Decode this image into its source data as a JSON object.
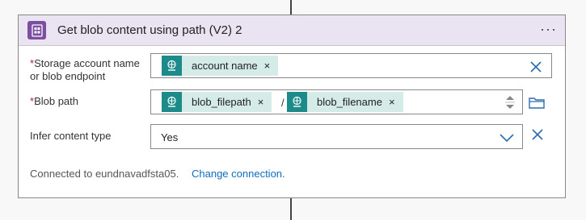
{
  "action": {
    "title": "Get blob content using path (V2) 2",
    "more_label": "···"
  },
  "fields": {
    "storage": {
      "required_mark": "*",
      "label_line1": "Storage account name",
      "label_line2": "or blob endpoint",
      "token": "account name",
      "token_remove": "×"
    },
    "blob_path": {
      "required_mark": "*",
      "label": "Blob path",
      "token1": "blob_filepath",
      "token1_remove": "×",
      "separator": "/",
      "token2": "blob_filename",
      "token2_remove": "×"
    },
    "infer": {
      "label": "Infer content type",
      "value": "Yes"
    }
  },
  "footer": {
    "connected_text": "Connected to eundnavadfsta05.",
    "change_link": "Change connection."
  },
  "colors": {
    "header_bg": "#eae3f1",
    "action_icon_bg": "#7b4ea2",
    "token_bg": "#d4ebe8",
    "token_icon_bg": "#1e8b8b",
    "link": "#0f6cbd",
    "required": "#a4262c"
  }
}
